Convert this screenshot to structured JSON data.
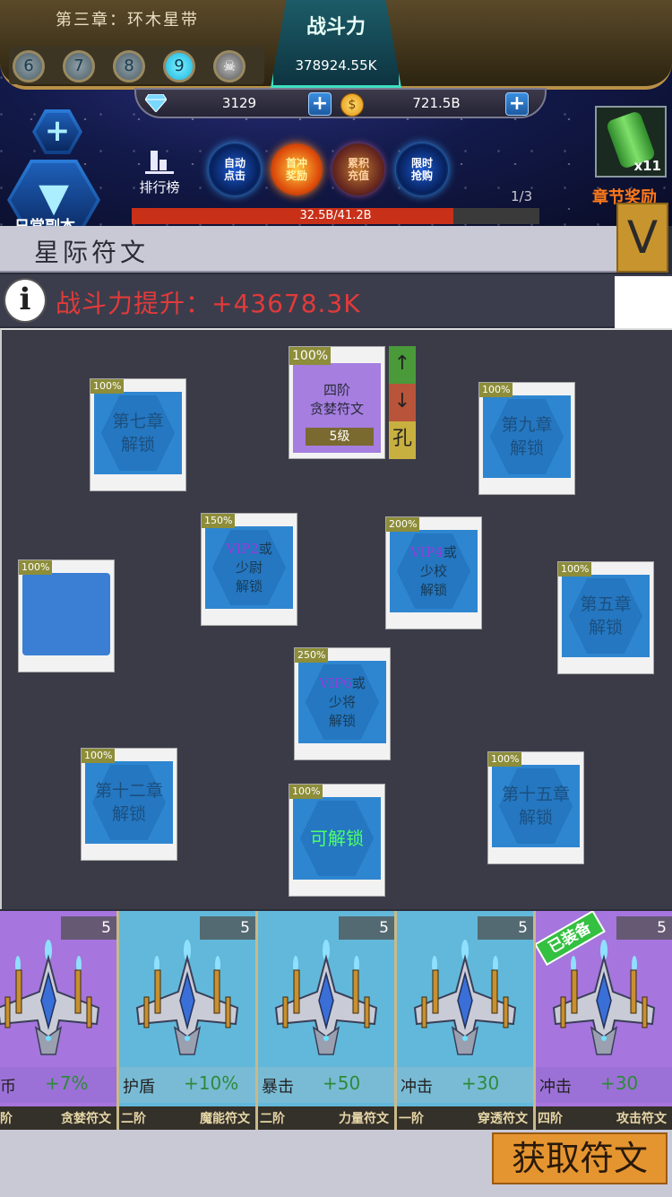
{
  "hud": {
    "chapter_title": "第三章：环木星带",
    "levels": [
      "6",
      "7",
      "8",
      "9"
    ],
    "active_level": "9",
    "skull": "☠",
    "power_label": "战斗力",
    "power_value": "378924.55K",
    "gems": "3129",
    "gold": "721.5B",
    "plus": "+",
    "rank_label": "排行榜",
    "daily_label": "日常副本",
    "orbs": [
      "自动\n点击",
      "首冲\n奖励",
      "累积\n充值",
      "限时\n抢购"
    ],
    "chest_count": "x11",
    "chest_label": "章节奖励",
    "progress_count": "1/3",
    "progress_text": "32.5B/41.2B",
    "progress_ratio": 0.789
  },
  "panel": {
    "title": "星际符文",
    "close": "V",
    "info_icon": "i",
    "info_text": "战斗力提升：+43678.3K"
  },
  "slots": {
    "equipped": {
      "pct": "100%",
      "line1": "四阶",
      "line2": "贪婪符文",
      "level": "5级"
    },
    "up": "↑",
    "down": "↓",
    "hole": "孔",
    "ch7": {
      "pct": "100%",
      "line1": "第七章",
      "line2": "解锁"
    },
    "ch9": {
      "pct": "100%",
      "line1": "第九章",
      "line2": "解锁"
    },
    "vip_lieutenant": {
      "pct": "150%",
      "vip": "VIP2",
      "line1": "或",
      "line2": "少尉",
      "line3": "解锁"
    },
    "vip_major": {
      "pct": "200%",
      "vip": "VIP4",
      "line1": "或",
      "line2": "少校",
      "line3": "解锁"
    },
    "blank": {
      "pct": "100%"
    },
    "ch5": {
      "pct": "100%",
      "line1": "第五章",
      "line2": "解锁"
    },
    "vip_general": {
      "pct": "250%",
      "vip": "VIP6",
      "line1": "或",
      "line2": "少将",
      "line3": "解锁"
    },
    "ch12": {
      "pct": "100%",
      "line1": "第十二章",
      "line2": "解锁"
    },
    "unlockable": {
      "pct": "100%",
      "line1": "可解锁"
    },
    "ch15": {
      "pct": "100%",
      "line1": "第十五章",
      "line2": "解锁"
    }
  },
  "cards": [
    {
      "count": "5",
      "stat": "币",
      "value": "+7%",
      "tier": "阶",
      "name": "贪婪符文",
      "color": "purple"
    },
    {
      "count": "5",
      "stat": "护盾",
      "value": "+10%",
      "tier": "二阶",
      "name": "魔能符文",
      "color": "cyan"
    },
    {
      "count": "5",
      "stat": "暴击",
      "value": "+50",
      "tier": "二阶",
      "name": "力量符文",
      "color": "cyan"
    },
    {
      "count": "5",
      "stat": "冲击",
      "value": "+30",
      "tier": "一阶",
      "name": "穿透符文",
      "color": "cyan"
    },
    {
      "count": "5",
      "stat": "冲击",
      "value": "+30",
      "tier": "四阶",
      "name": "攻击符文",
      "color": "purple",
      "tag": "已装备"
    }
  ],
  "get_button": "获取符文",
  "colors": {
    "accent_gold": "#c8942e",
    "info_red": "#e23a3a",
    "stat_green": "#2e8a3a"
  }
}
